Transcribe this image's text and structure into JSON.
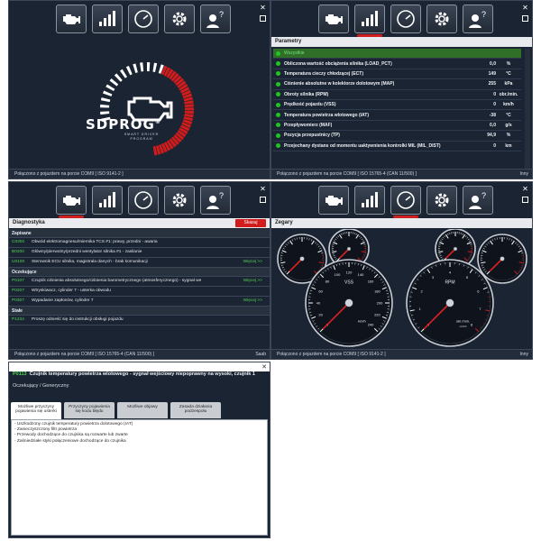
{
  "toolbar_icons": [
    "engine-icon",
    "bars-icon",
    "gauge-icon",
    "gear-icon",
    "technician-help-icon"
  ],
  "logo": {
    "brand": "SDPROG",
    "registered": "®",
    "tagline_1": "SMART DRIVER",
    "tagline_2": "PROGRAM"
  },
  "status": {
    "panel1": "Połączono z pojazdem na porcie COM9  [ ISO 9141-2 ]",
    "panel2": "Połączono z pojazdem na porcie COM9  [ ISO 15765-4 (CAN 11/500) ]",
    "panel2_right": "Inny",
    "panel3": "Połączono z pojazdem na porcie COM9  [ ISO 15765-4 (CAN 11/500) ]",
    "panel3_right": "Saab",
    "panel4": "Połączono z pojazdem na porcie COM9  [ ISO 9141-2 ]",
    "panel4_right": "Inny"
  },
  "parameters": {
    "title": "Parametry",
    "all_label": "Wszystkie",
    "rows": [
      {
        "name": "Obliczona wartość obciążenia silnika (LOAD_PCT)",
        "value": "0,0",
        "unit": "%"
      },
      {
        "name": "Temperatura cieczy chłodzącej (ECT)",
        "value": "149",
        "unit": "°C"
      },
      {
        "name": "Ciśnienie absolutne w kolektorze dolotowym (MAP)",
        "value": "255",
        "unit": "kPa"
      },
      {
        "name": "Obroty silnika (RPM)",
        "value": "0",
        "unit": "obr./min."
      },
      {
        "name": "Prędkość pojazdu (VSS)",
        "value": "0",
        "unit": "km/h"
      },
      {
        "name": "Temperatura powietrza wlotowego (IAT)",
        "value": "-38",
        "unit": "°C"
      },
      {
        "name": "Przepływomierz (MAF)",
        "value": "0,0",
        "unit": "g/s"
      },
      {
        "name": "Pozycja przepustnicy (TP)",
        "value": "94,9",
        "unit": "%"
      },
      {
        "name": "Przejechany dystans od momentu uaktywnienia kontrolki MIL (MIL_DIST)",
        "value": "0",
        "unit": "km"
      }
    ]
  },
  "diagnostics": {
    "title": "Diagnostyka",
    "erase_label": "Skasuj",
    "groups": [
      {
        "name": "Zapisane",
        "rows": [
          {
            "code": "C0300",
            "desc": "Obwód elektromagnesu/miernika TCS #1: prawy, przedni - awaria",
            "more": ""
          },
          {
            "code": "B0200",
            "desc": "Główny/pierwotny/przedni wentylator silnika #1 - zasilanie",
            "more": ""
          },
          {
            "code": "U0100",
            "desc": "Sterownik ECU silnika, magistrala danych - brak komunikacji",
            "more": "Więcej >>"
          }
        ]
      },
      {
        "name": "Oczekujące",
        "rows": [
          {
            "code": "P0107",
            "desc": "Czujnik ciśnienia absolutnego/ciśnienia barometrycznego (atmosferycznego) - sygnał we",
            "more": "Więcej >>"
          },
          {
            "code": "P0207",
            "desc": "Wtryskiwacz, cylinder 7 - usterka obwodu",
            "more": ""
          },
          {
            "code": "P0307",
            "desc": "Wypadanie zapłonów, cylinder 7",
            "more": "Więcej >>"
          }
        ]
      },
      {
        "name": "Stałe",
        "rows": [
          {
            "code": "P1234",
            "desc": "Proszę odnieść się do instrukcji obsługi pojazdu",
            "more": ""
          }
        ]
      }
    ]
  },
  "gauges": {
    "title": "Zegary",
    "vss_label": "VSS",
    "vss_unit": "km/h",
    "rpm_label": "RPM",
    "rpm_unit": "obr./min.",
    "rpm_mult": "x1000",
    "vss_ticks": [
      "0",
      "20",
      "40",
      "60",
      "80",
      "100",
      "120",
      "140",
      "160",
      "180",
      "200",
      "220",
      "240"
    ],
    "rpm_ticks": [
      "0",
      "1",
      "2",
      "3",
      "4",
      "5",
      "6",
      "7",
      "8"
    ]
  },
  "dtc_detail": {
    "code": "P0113",
    "title": "Czujnik temperatury powietrza wlotowego - sygnał wejściowy niepoprawny na wysoki, czujnik 1",
    "type": "Oczekujący / Generyczny",
    "tabs": [
      {
        "line1": "Możliwe przyczyny",
        "line2": "pojawienia się usterki"
      },
      {
        "line1": "Przyczyny pojawienia",
        "line2": "się kodu błędu"
      },
      {
        "line1": "Możliwe objawy",
        "line2": ""
      },
      {
        "line1": "Zasada działania",
        "line2": "podzespołu"
      }
    ],
    "causes": [
      "- Uszkodzony czujnik temperatury powietrza dolotowego (IAT)",
      "- Zanieczyszczony filtr powietrza",
      "- Przewody dochodzące do czujnika są rozwarte lub zwarte",
      "- Zaśniedziałe styki połączeniowe dochodzące do czujnika"
    ]
  }
}
